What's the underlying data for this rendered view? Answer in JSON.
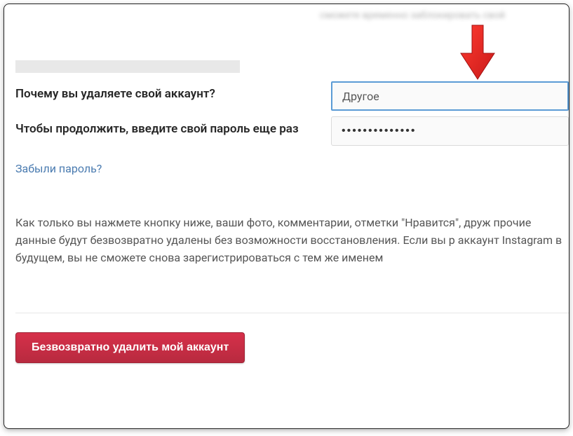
{
  "top_blur_text": "сможете временно заблокировать свой",
  "form": {
    "reason_label": "Почему вы удаляете свой аккаунт?",
    "reason_value": "Другое",
    "password_label": "Чтобы продолжить, введите свой пароль еще раз",
    "password_value": "••••••••••••••",
    "forgot_link": "Забыли пароль?"
  },
  "warning_text": "Как только вы нажмете кнопку ниже, ваши фото, комментарии, отметки \"Нравится\", друж прочие данные будут безвозвратно удалены без возможности восстановления. Если вы р аккаунт Instagram в будущем, вы не сможете снова зарегистрироваться с тем же именем",
  "delete_button_label": "Безвозвратно удалить мой аккаунт"
}
